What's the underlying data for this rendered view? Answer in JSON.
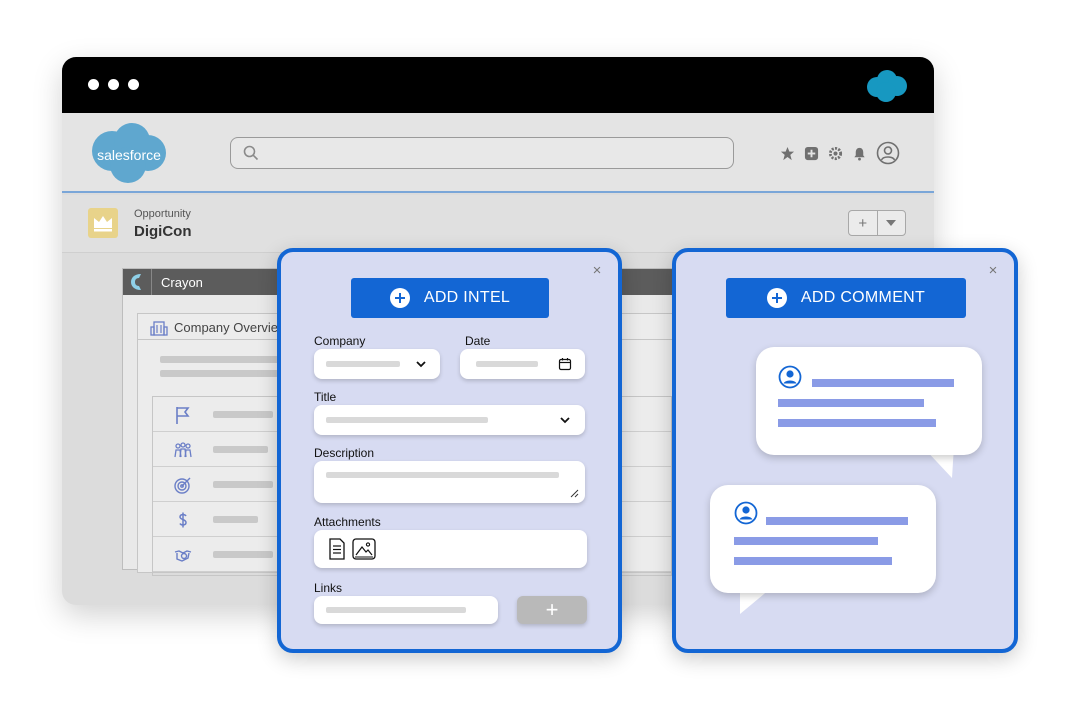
{
  "browser": {
    "logo_text": "salesforce",
    "search": {
      "placeholder": ""
    },
    "header_icons": [
      "star-icon",
      "add-icon",
      "gear-icon",
      "bell-icon",
      "avatar-icon"
    ]
  },
  "opportunity": {
    "label": "Opportunity",
    "name": "DigiCon",
    "add_label": "+"
  },
  "crayon": {
    "title": "Crayon",
    "company_overview": "Company Overview",
    "rows": [
      "flag-icon",
      "people-icon",
      "target-icon",
      "dollar-icon",
      "handshake-icon"
    ]
  },
  "intel": {
    "button_label": "ADD INTEL",
    "close": "×",
    "company_label": "Company",
    "date_label": "Date",
    "title_label": "Title",
    "description_label": "Description",
    "attachments_label": "Attachments",
    "links_label": "Links",
    "add_link_label": "+"
  },
  "comment": {
    "button_label": "ADD COMMENT",
    "close": "×"
  },
  "colors": {
    "accent": "#1366d4",
    "modal_bg": "#d7dbf2",
    "comment_line": "#8a9be6",
    "salesforce_blue": "#1798c1"
  }
}
